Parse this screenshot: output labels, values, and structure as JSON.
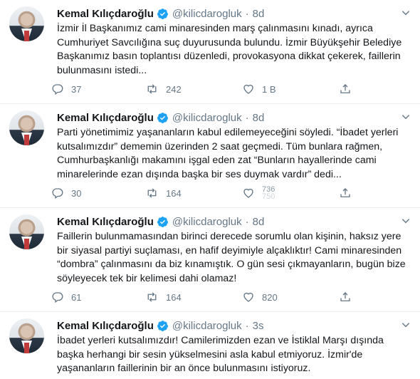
{
  "colors": {
    "blue": "#1da1f2",
    "grey": "#657786",
    "border": "#e6ecf0"
  },
  "tweets": [
    {
      "name": "Kemal Kılıçdaroğlu",
      "handle": "@kilicdarogluk",
      "separator": "·",
      "time": "8d",
      "text": "İzmir İl Başkanımız cami minaresinden marş çalınmasını kınadı, ayrıca Cumhuriyet Savcılığına suç duyurusunda bulundu. İzmir Büyükşehir Belediye Başkanımız basın toplantısı düzenledi, provokasyona dikkat çekerek, faillerin bulunmasını istedi...",
      "replies": "37",
      "retweets": "242",
      "likes": "1 B"
    },
    {
      "name": "Kemal Kılıçdaroğlu",
      "handle": "@kilicdarogluk",
      "separator": "·",
      "time": "8d",
      "text": "Parti yönetimimiz yaşananların kabul edilemeyeceğini söyledi. “İbadet yerleri kutsalımızdır” dememin üzerinden 2 saat geçmedi. Tüm bunlara rağmen, Cumhurbaşkanlığı makamını işgal eden zat “Bunların hayallerinde cami minarelerinde ezan dışında başka bir ses duymak vardır” dedi...",
      "replies": "30",
      "retweets": "164",
      "likes_top": "736",
      "likes_bottom": "750"
    },
    {
      "name": "Kemal Kılıçdaroğlu",
      "handle": "@kilicdarogluk",
      "separator": "·",
      "time": "8d",
      "text": "Faillerin bulunmamasından birinci derecede sorumlu olan kişinin, haksız yere bir siyasal partiyi suçlaması, en hafif deyimiyle alçaklıktır! Cami minaresinden “dombra” çalınmasını da biz kınamıştık. O gün sesi çıkmayanların, bugün bize söyleyecek tek bir kelimesi dahi olamaz!",
      "replies": "61",
      "retweets": "164",
      "likes": "820"
    },
    {
      "name": "Kemal Kılıçdaroğlu",
      "handle": "@kilicdarogluk",
      "separator": "·",
      "time": "3s",
      "text": "İbadet yerleri kutsalımızdır! Camilerimizden ezan ve İstiklal Marşı dışında başka herhangi bir sesin yükselmesini asla kabul etmiyoruz. İzmir'de yaşananların faillerinin bir an önce bulunmasını istiyoruz."
    }
  ]
}
